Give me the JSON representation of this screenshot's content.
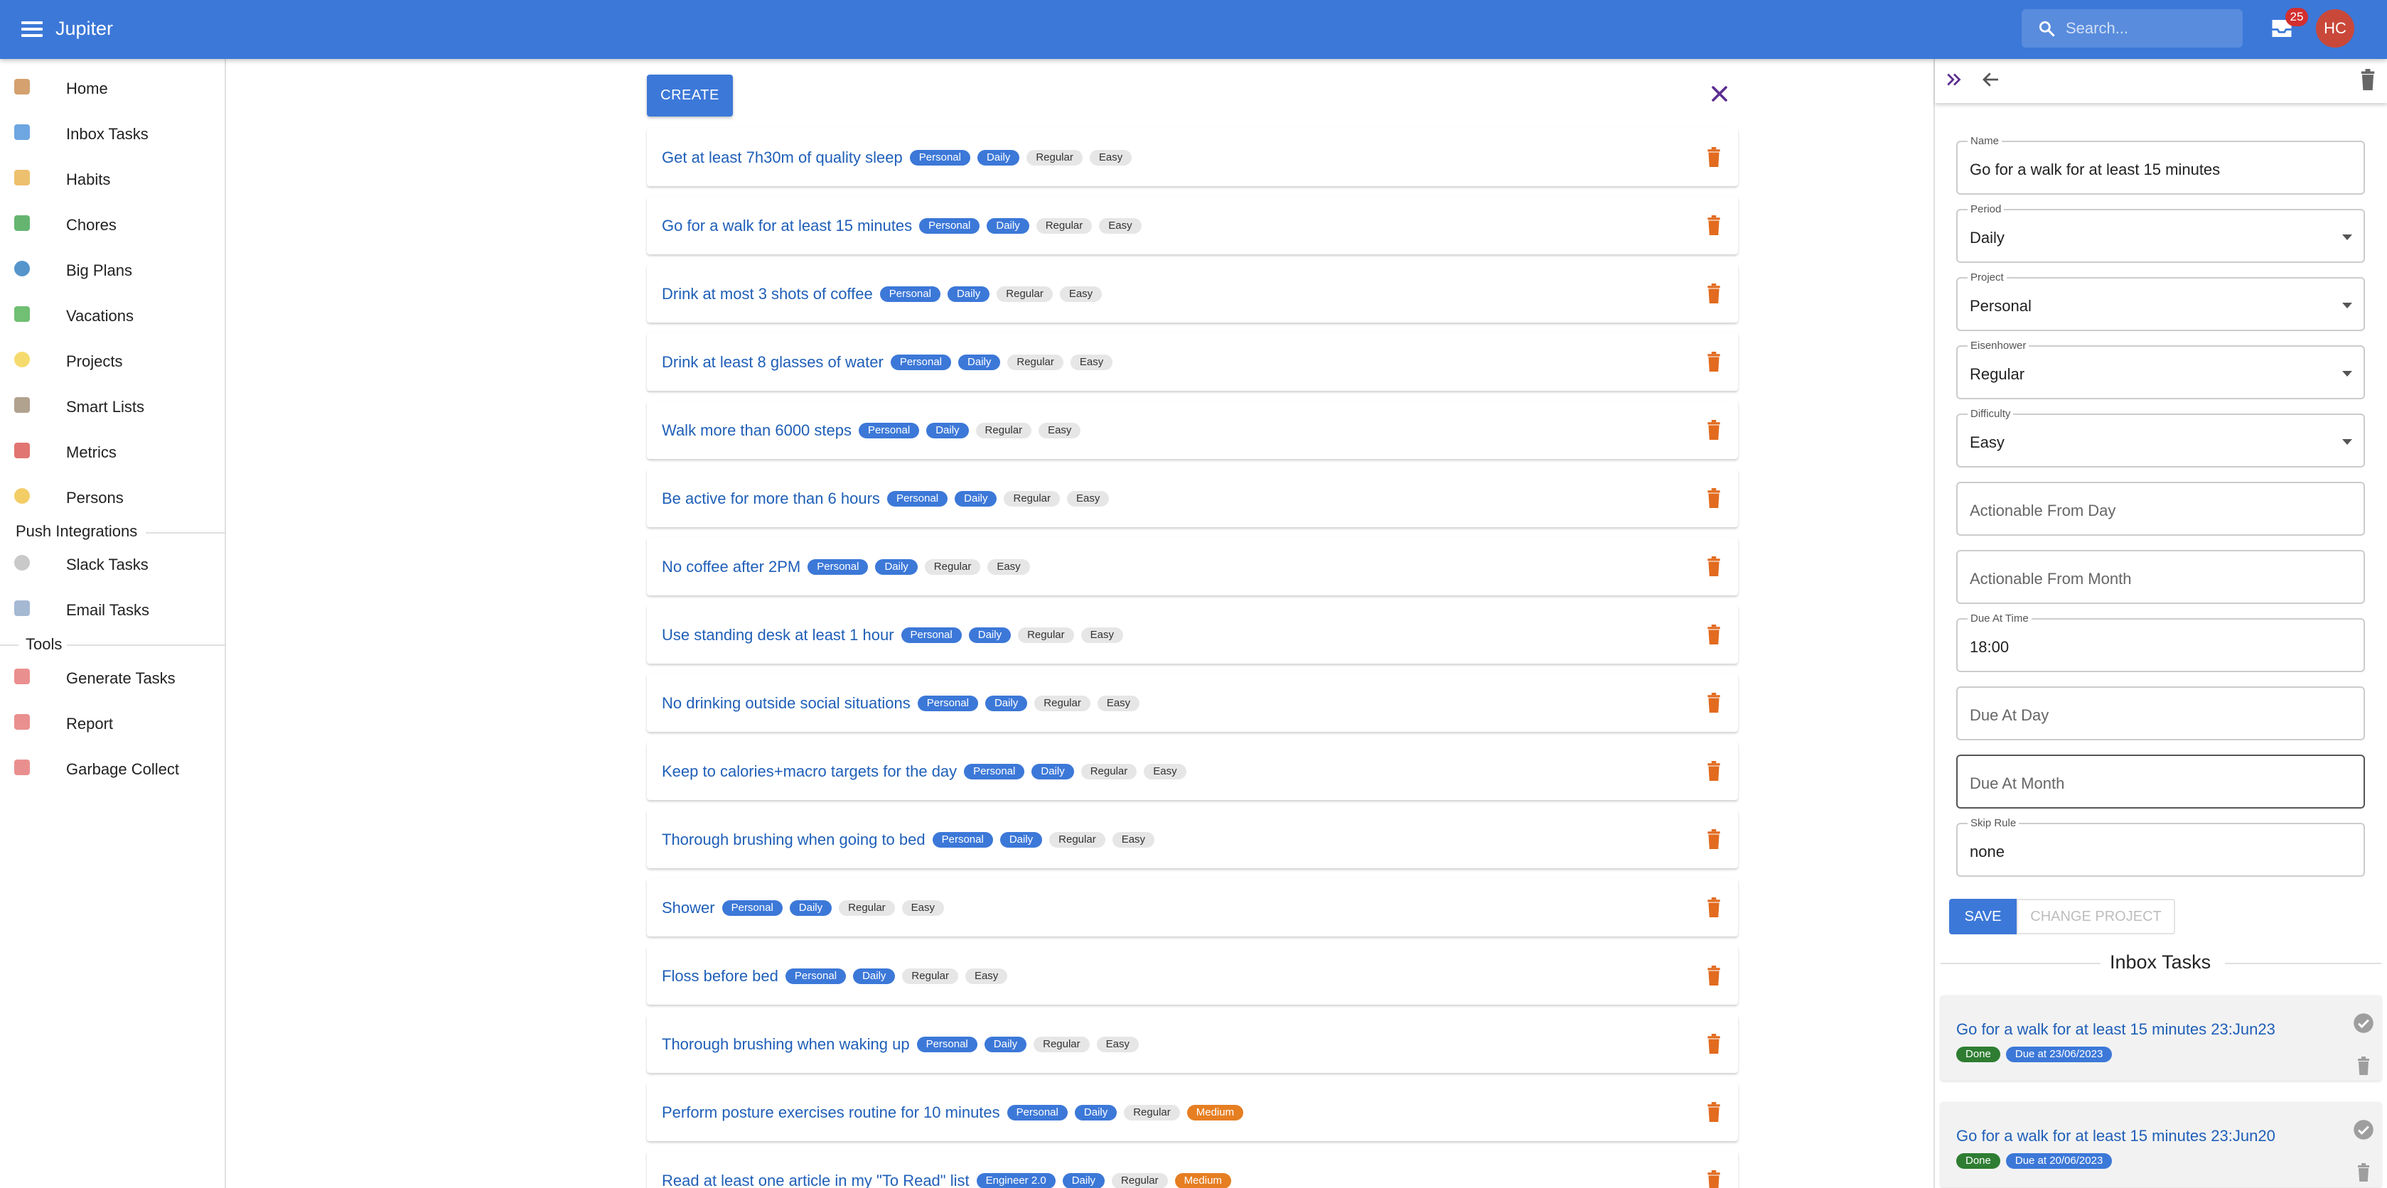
{
  "app": {
    "title": "Jupiter",
    "search_placeholder": "Search...",
    "inbox_badge": "25",
    "avatar_initials": "HC",
    "brand_color": "#3c78d8"
  },
  "sidebar": {
    "items": [
      {
        "label": "Home",
        "icon": "home-icon",
        "color": "#c98a4b"
      },
      {
        "label": "Inbox Tasks",
        "icon": "inbox-tasks-icon",
        "color": "#4a90d9"
      },
      {
        "label": "Habits",
        "icon": "habits-icon",
        "color": "#e8b04a"
      },
      {
        "label": "Chores",
        "icon": "chores-icon",
        "color": "#3fa34d"
      },
      {
        "label": "Big Plans",
        "icon": "big-plans-icon",
        "color": "#2b7bbf"
      },
      {
        "label": "Vacations",
        "icon": "vacations-icon",
        "color": "#4caf50"
      },
      {
        "label": "Projects",
        "icon": "projects-icon",
        "color": "#f2d24a"
      },
      {
        "label": "Smart Lists",
        "icon": "smart-lists-icon",
        "color": "#9e8b73"
      },
      {
        "label": "Metrics",
        "icon": "metrics-icon",
        "color": "#d9534f"
      },
      {
        "label": "Persons",
        "icon": "persons-icon",
        "color": "#f0c040"
      }
    ],
    "push_integrations_label": "Push Integrations",
    "push_items": [
      {
        "label": "Slack Tasks",
        "icon": "slack-tasks-icon",
        "color": "#bbbbbb"
      },
      {
        "label": "Email Tasks",
        "icon": "email-tasks-icon",
        "color": "#8fa8c8"
      }
    ],
    "tools_label": "Tools",
    "tool_items": [
      {
        "label": "Generate Tasks",
        "icon": "generate-tasks-icon",
        "color": "#e57373"
      },
      {
        "label": "Report",
        "icon": "report-icon",
        "color": "#e57373"
      },
      {
        "label": "Garbage Collect",
        "icon": "garbage-collect-icon",
        "color": "#e57373"
      }
    ]
  },
  "main": {
    "create_label": "CREATE",
    "habits": [
      {
        "name": "Get at least 7h30m of quality sleep",
        "project": "Personal",
        "period": "Daily",
        "eisen": "Regular",
        "difficulty": "Easy"
      },
      {
        "name": "Go for a walk for at least 15 minutes",
        "project": "Personal",
        "period": "Daily",
        "eisen": "Regular",
        "difficulty": "Easy"
      },
      {
        "name": "Drink at most 3 shots of coffee",
        "project": "Personal",
        "period": "Daily",
        "eisen": "Regular",
        "difficulty": "Easy"
      },
      {
        "name": "Drink at least 8 glasses of water",
        "project": "Personal",
        "period": "Daily",
        "eisen": "Regular",
        "difficulty": "Easy"
      },
      {
        "name": "Walk more than 6000 steps",
        "project": "Personal",
        "period": "Daily",
        "eisen": "Regular",
        "difficulty": "Easy"
      },
      {
        "name": "Be active for more than 6 hours",
        "project": "Personal",
        "period": "Daily",
        "eisen": "Regular",
        "difficulty": "Easy"
      },
      {
        "name": "No coffee after 2PM",
        "project": "Personal",
        "period": "Daily",
        "eisen": "Regular",
        "difficulty": "Easy"
      },
      {
        "name": "Use standing desk at least 1 hour",
        "project": "Personal",
        "period": "Daily",
        "eisen": "Regular",
        "difficulty": "Easy"
      },
      {
        "name": "No drinking outside social situations",
        "project": "Personal",
        "period": "Daily",
        "eisen": "Regular",
        "difficulty": "Easy"
      },
      {
        "name": "Keep to calories+macro targets for the day",
        "project": "Personal",
        "period": "Daily",
        "eisen": "Regular",
        "difficulty": "Easy"
      },
      {
        "name": "Thorough brushing when going to bed",
        "project": "Personal",
        "period": "Daily",
        "eisen": "Regular",
        "difficulty": "Easy"
      },
      {
        "name": "Shower",
        "project": "Personal",
        "period": "Daily",
        "eisen": "Regular",
        "difficulty": "Easy"
      },
      {
        "name": "Floss before bed",
        "project": "Personal",
        "period": "Daily",
        "eisen": "Regular",
        "difficulty": "Easy"
      },
      {
        "name": "Thorough brushing when waking up",
        "project": "Personal",
        "period": "Daily",
        "eisen": "Regular",
        "difficulty": "Easy"
      },
      {
        "name": "Perform posture exercises routine for 10 minutes",
        "project": "Personal",
        "period": "Daily",
        "eisen": "Regular",
        "difficulty": "Medium"
      },
      {
        "name": "Read at least one article in my \"To Read\" list",
        "project": "Engineer 2.0",
        "period": "Daily",
        "eisen": "Regular",
        "difficulty": "Medium"
      }
    ]
  },
  "detail": {
    "name_label": "Name",
    "name_value": "Go for a walk for at least 15 minutes",
    "period_label": "Period",
    "period_value": "Daily",
    "project_label": "Project",
    "project_value": "Personal",
    "eisen_label": "Eisenhower",
    "eisen_value": "Regular",
    "difficulty_label": "Difficulty",
    "difficulty_value": "Easy",
    "actionable_day_placeholder": "Actionable From Day",
    "actionable_month_placeholder": "Actionable From Month",
    "due_time_label": "Due At Time",
    "due_time_value": "18:00",
    "due_day_placeholder": "Due At Day",
    "due_month_placeholder": "Due At Month",
    "skip_rule_label": "Skip Rule",
    "skip_rule_value": "none",
    "save_label": "SAVE",
    "change_project_label": "CHANGE PROJECT",
    "inbox_tasks_title": "Inbox Tasks",
    "inbox_tasks": [
      {
        "name": "Go for a walk for at least 15 minutes 23:Jun23",
        "status": "Done",
        "due": "Due at 23/06/2023"
      },
      {
        "name": "Go for a walk for at least 15 minutes 23:Jun20",
        "status": "Done",
        "due": "Due at 20/06/2023"
      }
    ]
  }
}
